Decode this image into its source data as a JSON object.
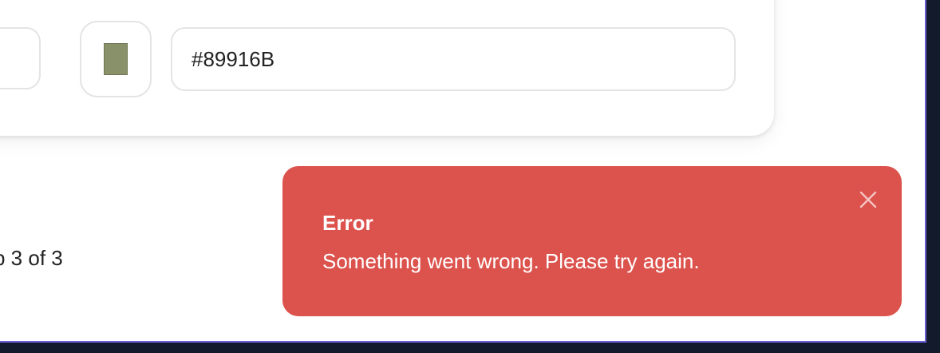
{
  "color_picker": {
    "hex_value": "#89916B",
    "swatch_color": "#89916B"
  },
  "wizard": {
    "step_text": "p 3 of 3"
  },
  "toast": {
    "title": "Error",
    "message": "Something went wrong. Please try again.",
    "background_color": "#DC524C",
    "close_icon": "close-icon"
  }
}
